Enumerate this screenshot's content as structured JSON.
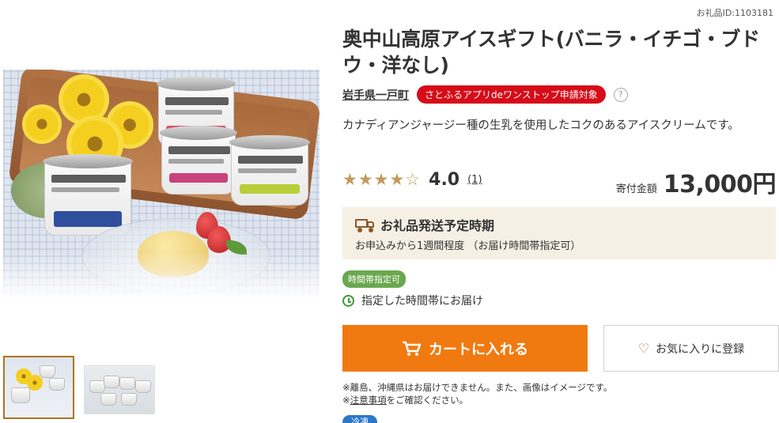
{
  "gift_id": "お礼品ID:1103181",
  "product": {
    "title": "奥中山高原アイスギフト(バニラ・イチゴ・ブドウ・洋なし)",
    "municipality": "岩手県一戸町",
    "onestop_badge": "さとふるアプリdeワンストップ申請対象",
    "help_icon": "?",
    "description": "カナディアンジャージー種の生乳を使用したコクのあるアイスクリームです。"
  },
  "rating": {
    "stars_text": "★★★★☆",
    "stars_value": 4,
    "score": "4.0",
    "count": "(1)"
  },
  "price": {
    "label": "寄付金額",
    "amount": "13,000円"
  },
  "shipping": {
    "heading": "お礼品発送予定時期",
    "note": "お申込みから1週間程度 （お届け時間帯指定可）"
  },
  "delivery": {
    "badge": "時間帯指定可",
    "text": "指定した時間帯にお届け"
  },
  "buttons": {
    "cart": "カートに入れる",
    "favorite": "お気に入りに登録"
  },
  "notes": {
    "line1": "※離島、沖縄県はお届けできません。また、画像はイメージです。",
    "line2_prefix": "※",
    "line2_link": "注意事項",
    "line2_suffix": "をご確認ください。"
  },
  "bottom_badge": "冷凍",
  "icons": {
    "cart": "cart-icon",
    "heart": "heart-icon",
    "truck": "truck-icon",
    "clock": "clock-icon",
    "help": "help-icon"
  },
  "colors": {
    "accent_orange": "#f07a10",
    "badge_red": "#d60c18",
    "badge_green": "#6aa84f",
    "star_gold": "#c49a5c",
    "shipping_bg": "#f6f0e4"
  }
}
